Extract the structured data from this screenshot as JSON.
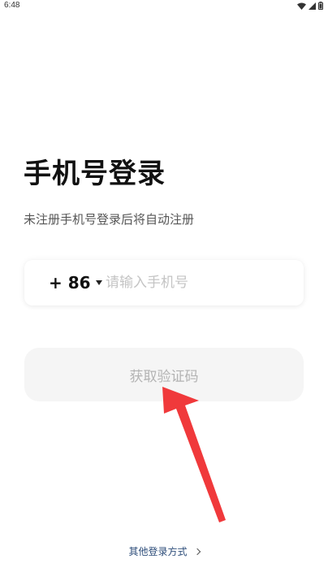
{
  "status_bar": {
    "time": "6:48",
    "icons": [
      "wifi-icon",
      "signal-icon",
      "battery-icon"
    ]
  },
  "login": {
    "title": "手机号登录",
    "subtitle": "未注册手机号登录后将自动注册",
    "country_code": "+ 86",
    "phone_placeholder": "请输入手机号",
    "phone_value": "",
    "get_code_label": "获取验证码",
    "other_login_label": "其他登录方式"
  },
  "colors": {
    "annotation_arrow": "#f0393b",
    "disabled_button_bg": "#f5f5f5",
    "link_text": "#2d4d7a"
  }
}
